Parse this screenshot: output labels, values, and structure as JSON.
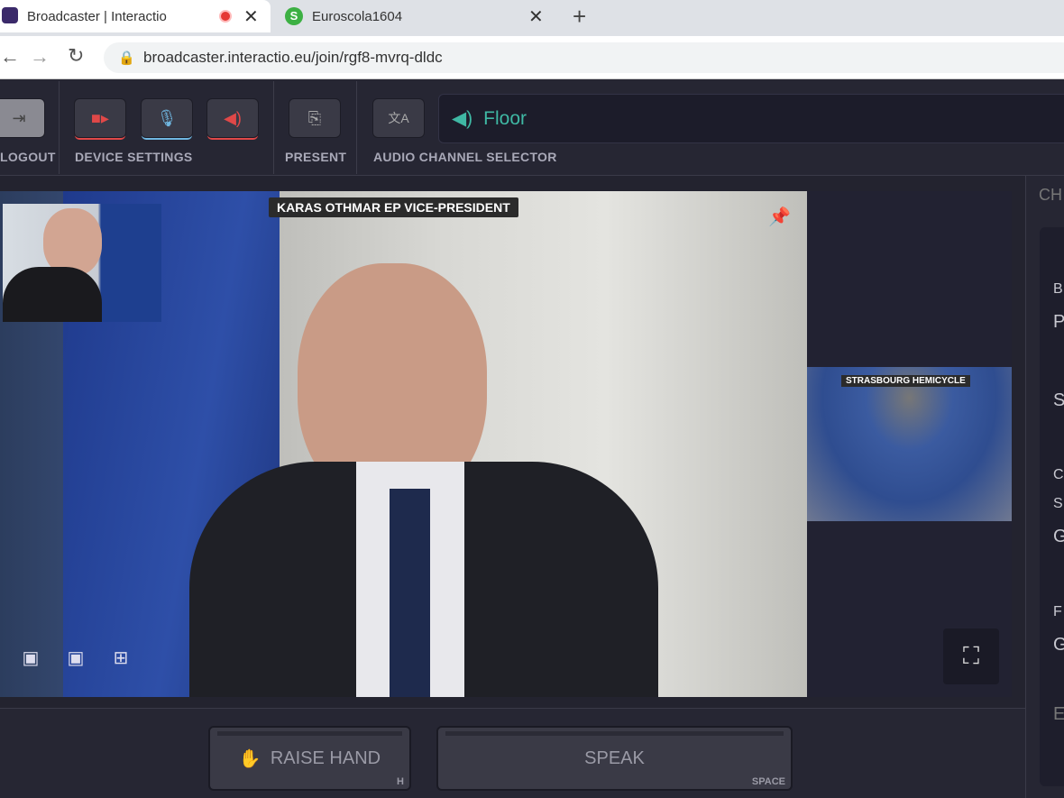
{
  "browser": {
    "tabs": [
      {
        "title": "Broadcaster | Interactio",
        "recording": true
      },
      {
        "title": "Euroscola1604"
      }
    ],
    "url": "broadcaster.interactio.eu/join/rgf8-mvrq-dldc"
  },
  "toolbar": {
    "logout": "LOGOUT",
    "device_settings": "DEVICE SETTINGS",
    "present": "PRESENT",
    "audio_channel_selector": "AUDIO CHANNEL SELECTOR",
    "channel": "Floor"
  },
  "video": {
    "speaker_name": "KARAS OTHMAR EP VICE-PRESIDENT",
    "side_feed": "STRASBOURG HEMICYCLE"
  },
  "right_panel": {
    "header": "CH",
    "letters": [
      "B",
      "P",
      "S",
      "C",
      "S",
      "G",
      "F",
      "G",
      "E"
    ]
  },
  "bottom": {
    "raise_hand": "RAISE HAND",
    "raise_hand_key": "H",
    "speak": "SPEAK",
    "speak_key": "SPACE"
  },
  "colors": {
    "accent": "#3fb8a4",
    "alert": "#e04848",
    "muted_mic": "#6fb6e0"
  }
}
